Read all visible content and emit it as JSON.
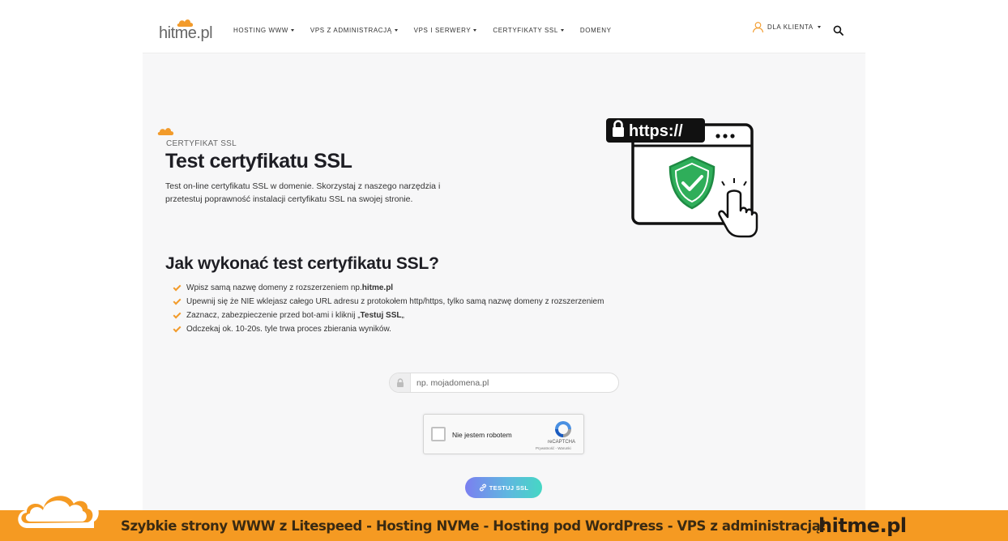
{
  "brand": {
    "logo_text": "hitme.pl",
    "accent_color": "#f29b2b",
    "banner_color": "#f59a22"
  },
  "nav": {
    "items": [
      {
        "label": "HOSTING WWW",
        "has_dropdown": true
      },
      {
        "label": "VPS Z ADMINISTRACJĄ",
        "has_dropdown": true
      },
      {
        "label": "VPS I SERWERY",
        "has_dropdown": true
      },
      {
        "label": "CERTYFIKATY SSL",
        "has_dropdown": true
      },
      {
        "label": "DOMENY",
        "has_dropdown": false
      }
    ],
    "client_label": "DLA KLIENTA",
    "search_icon": "search-icon",
    "user_icon": "user-icon"
  },
  "hero": {
    "eyebrow": "CERTYFIKAT SSL",
    "title": "Test certyfikatu SSL",
    "description": "Test on-line certyfikatu SSL w domenie. Skorzystaj z naszego narzędzia i przetestuj poprawność instalacji certyfikatu SSL na swojej stronie.",
    "illustration_label": "https://"
  },
  "howto": {
    "title": "Jak wykonać test certyfikatu SSL?",
    "steps": [
      {
        "pre": "Wpisz samą nazwę domeny z rozszerzeniem np. ",
        "bold": "hitme.pl",
        "post": ""
      },
      {
        "pre": "Upewnij się że NIE wklejasz całego URL adresu z protokołem http/https, tylko samą nazwę domeny z rozszerzeniem",
        "bold": "",
        "post": ""
      },
      {
        "pre": "Zaznacz, zabezpieczenie przed bot-ami i kliknij „",
        "bold": "Testuj SSL",
        "post": "„"
      },
      {
        "pre": "Odczekaj ok. 10-20s. tyle trwa proces zbierania wyników.",
        "bold": "",
        "post": ""
      }
    ]
  },
  "form": {
    "domain_placeholder": "np. mojadomena.pl",
    "domain_value": "",
    "captcha_label": "Nie jestem robotem",
    "captcha_brand": "reCAPTCHA",
    "captcha_links": "Prywatność - Warunki",
    "submit_label": "TESTUJ SSL"
  },
  "banner": {
    "text": "Szybkie strony WWW z Litespeed - Hosting  NVMe - Hosting pod WordPress - VPS z administracją!",
    "brand": "hitme.pl"
  }
}
